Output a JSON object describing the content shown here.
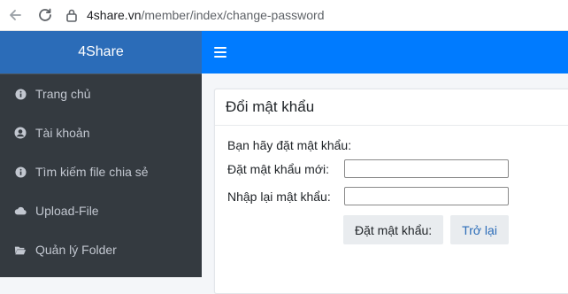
{
  "browser": {
    "url_host": "4share.vn",
    "url_path": "/member/index/change-password"
  },
  "sidebar": {
    "brand": "4Share",
    "items": [
      {
        "label": "Trang chủ",
        "icon": "info-circle-icon"
      },
      {
        "label": "Tài khoản",
        "icon": "user-circle-icon"
      },
      {
        "label": "Tìm kiếm file chia sẻ",
        "icon": "info-circle-icon"
      },
      {
        "label": "Upload-File",
        "icon": "cloud-icon"
      },
      {
        "label": "Quản lý Folder",
        "icon": "folder-open-icon"
      }
    ]
  },
  "colors": {
    "brand_bg": "#2b6cb8",
    "topbar_bg": "#007bff",
    "sidebar_bg": "#343a40"
  },
  "card": {
    "title": "Đổi mật khẩu",
    "intro": "Bạn hãy đặt mật khẩu:",
    "new_password_label": "Đặt mật khẩu mới:",
    "new_password_value": "",
    "confirm_password_label": "Nhập lại mật khẩu:",
    "confirm_password_value": "",
    "submit_label": "Đặt mật khẩu:",
    "back_label": "Trở lại"
  }
}
